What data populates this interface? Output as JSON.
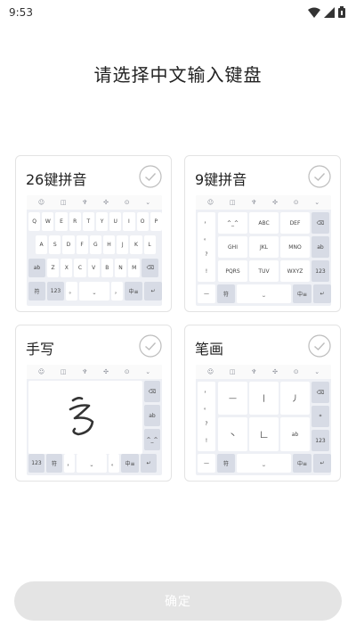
{
  "status_bar": {
    "time": "9:53",
    "icons": [
      "wifi-icon",
      "signal-icon",
      "battery-icon"
    ]
  },
  "title": "请选择中文输入键盘",
  "toolbar_icons": [
    "☺",
    "◫",
    "♆",
    "✣",
    "⊙",
    "⌄"
  ],
  "cards": {
    "qwerty": {
      "title": "26键拼音"
    },
    "t9": {
      "title": "9键拼音"
    },
    "handwriting": {
      "title": "手写"
    },
    "stroke": {
      "title": "笔画"
    }
  },
  "qwerty_rows": [
    [
      "Q",
      "W",
      "E",
      "R",
      "T",
      "Y",
      "U",
      "I",
      "O",
      "P"
    ],
    [
      "A",
      "S",
      "D",
      "F",
      "G",
      "H",
      "J",
      "K",
      "L"
    ],
    [
      "ab",
      "Z",
      "X",
      "C",
      "V",
      "B",
      "N",
      "M",
      "⌫"
    ],
    [
      "符",
      "123",
      "。",
      "⎵",
      "，",
      "中≡",
      "↵"
    ]
  ],
  "t9_keys": {
    "left": [
      "，",
      "。",
      "?",
      "!"
    ],
    "grid": [
      "^_^",
      "ABC",
      "DEF",
      "GHI",
      "JKL",
      "MNO",
      "PQRS",
      "TUV",
      "WXYZ"
    ],
    "right": [
      "⌫",
      "ab",
      "123"
    ],
    "bottom": [
      "—",
      "符",
      "⎵",
      "中≡",
      "↵"
    ]
  },
  "handwriting_keys": {
    "glyph": "§",
    "side": [
      "⌫",
      "ab",
      "^_^"
    ],
    "bottom": [
      "123",
      "符",
      "，",
      "⎵",
      "。",
      "中≡",
      "↵"
    ]
  },
  "stroke_keys": {
    "left": [
      "，",
      "。",
      "?",
      "!"
    ],
    "grid": [
      "—",
      "丨",
      "丿",
      "丶",
      "𠃊",
      "ab"
    ],
    "right": [
      "⌫",
      "*",
      "123"
    ],
    "bottom": [
      "—",
      "符",
      "⎵",
      "中≡",
      "↵"
    ]
  },
  "confirm_label": "确定",
  "colors": {
    "accent": "#d7dbe5",
    "button_disabled": "#e4e4e4",
    "card_border": "#e3e3e3"
  }
}
